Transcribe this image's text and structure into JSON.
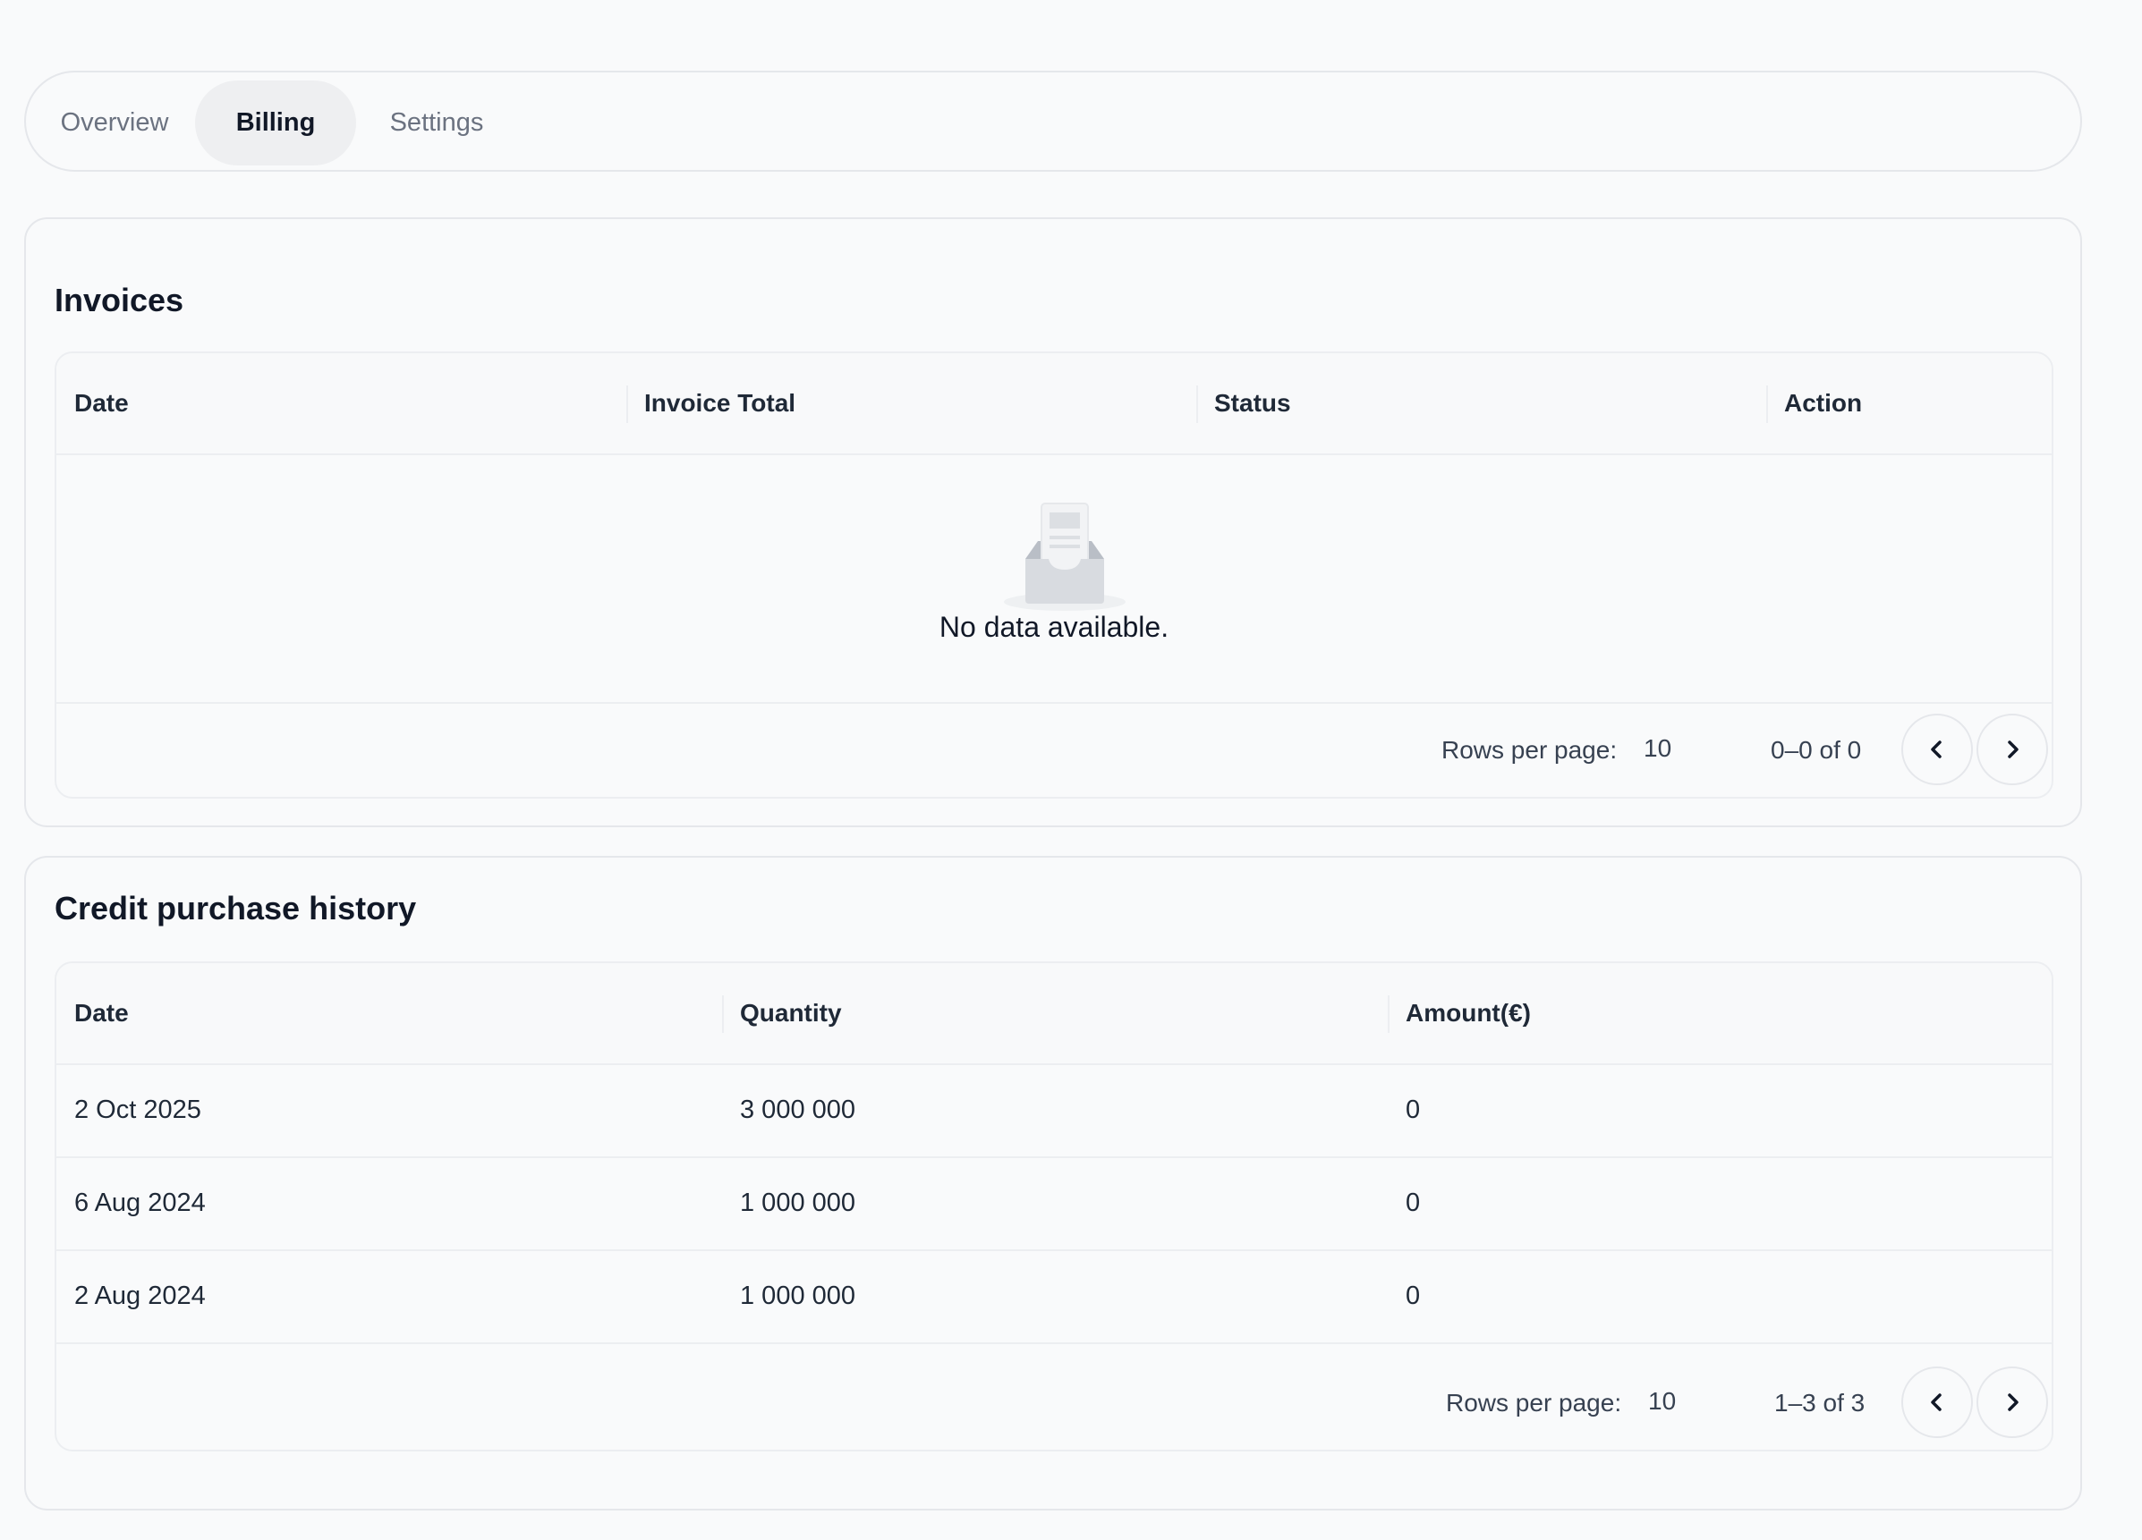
{
  "tabs": [
    {
      "label": "Overview"
    },
    {
      "label": "Billing"
    },
    {
      "label": "Settings"
    }
  ],
  "invoices": {
    "title": "Invoices",
    "columns": [
      "Date",
      "Invoice Total",
      "Status",
      "Action"
    ],
    "empty_text": "No data available.",
    "rows_per_page_label": "Rows per page:",
    "rows_per_page_value": "10",
    "page_info": "0–0 of 0"
  },
  "credit_history": {
    "title": "Credit purchase history",
    "columns": [
      "Date",
      "Quantity",
      "Amount(€)"
    ],
    "rows": [
      {
        "date": "2 Oct 2025",
        "quantity": "3 000 000",
        "amount": "0"
      },
      {
        "date": "6 Aug 2024",
        "quantity": "1 000 000",
        "amount": "0"
      },
      {
        "date": "2 Aug 2024",
        "quantity": "1 000 000",
        "amount": "0"
      }
    ],
    "rows_per_page_label": "Rows per page:",
    "rows_per_page_value": "10",
    "page_info": "1–3 of 3"
  },
  "icons": {
    "empty": "empty-inbox-icon",
    "prev": "chevron-left-icon",
    "next": "chevron-right-icon"
  }
}
